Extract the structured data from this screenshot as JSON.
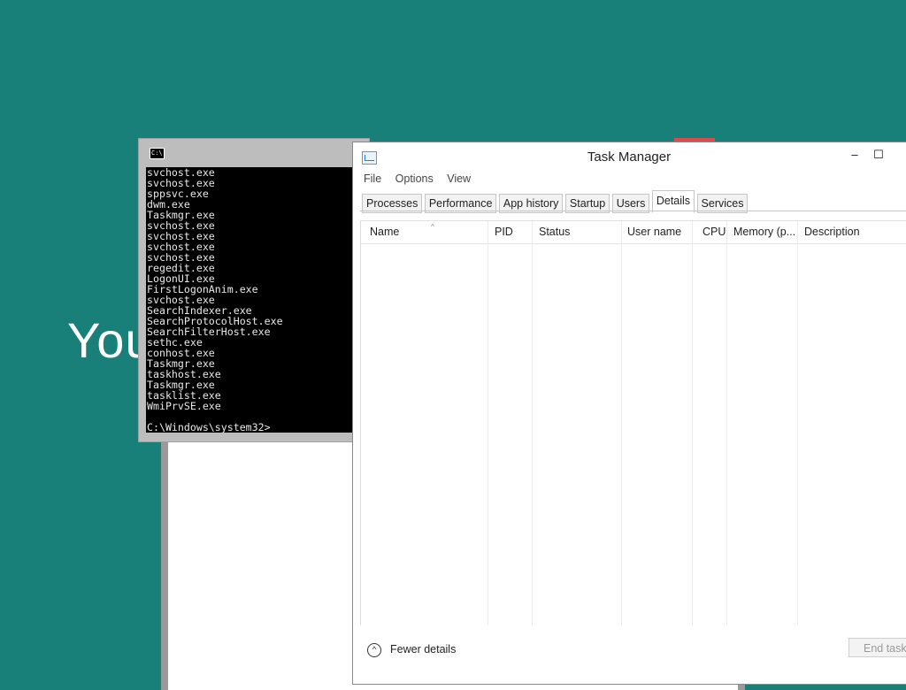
{
  "background": {
    "color": "#188079",
    "partial_text": "You"
  },
  "console": {
    "icon": "cmd-icon",
    "icon_text": "C:\\.",
    "lines": [
      "svchost.exe",
      "svchost.exe",
      "sppsvc.exe",
      "dwm.exe",
      "Taskmgr.exe",
      "svchost.exe",
      "svchost.exe",
      "svchost.exe",
      "svchost.exe",
      "regedit.exe",
      "LogonUI.exe",
      "FirstLogonAnim.exe",
      "svchost.exe",
      "SearchIndexer.exe",
      "SearchProtocolHost.exe",
      "SearchFilterHost.exe",
      "sethc.exe",
      "conhost.exe",
      "Taskmgr.exe",
      "taskhost.exe",
      "Taskmgr.exe",
      "tasklist.exe",
      "WmiPrvSE.exe"
    ],
    "prompt": "C:\\Windows\\system32>"
  },
  "task_manager": {
    "title": "Task Manager",
    "icon": "task-manager-icon",
    "minimize_glyph": "–",
    "maximize_glyph": "☐",
    "menu": [
      "File",
      "Options",
      "View"
    ],
    "tabs": [
      "Processes",
      "Performance",
      "App history",
      "Startup",
      "Users",
      "Details",
      "Services"
    ],
    "active_tab": "Details",
    "columns": [
      "Name",
      "PID",
      "Status",
      "User name",
      "CPU",
      "Memory (p...",
      "Description"
    ],
    "sort_indicator": "^",
    "rows": [],
    "fewer_details_glyph": "^",
    "fewer_details": "Fewer details",
    "end_task": "End task"
  }
}
